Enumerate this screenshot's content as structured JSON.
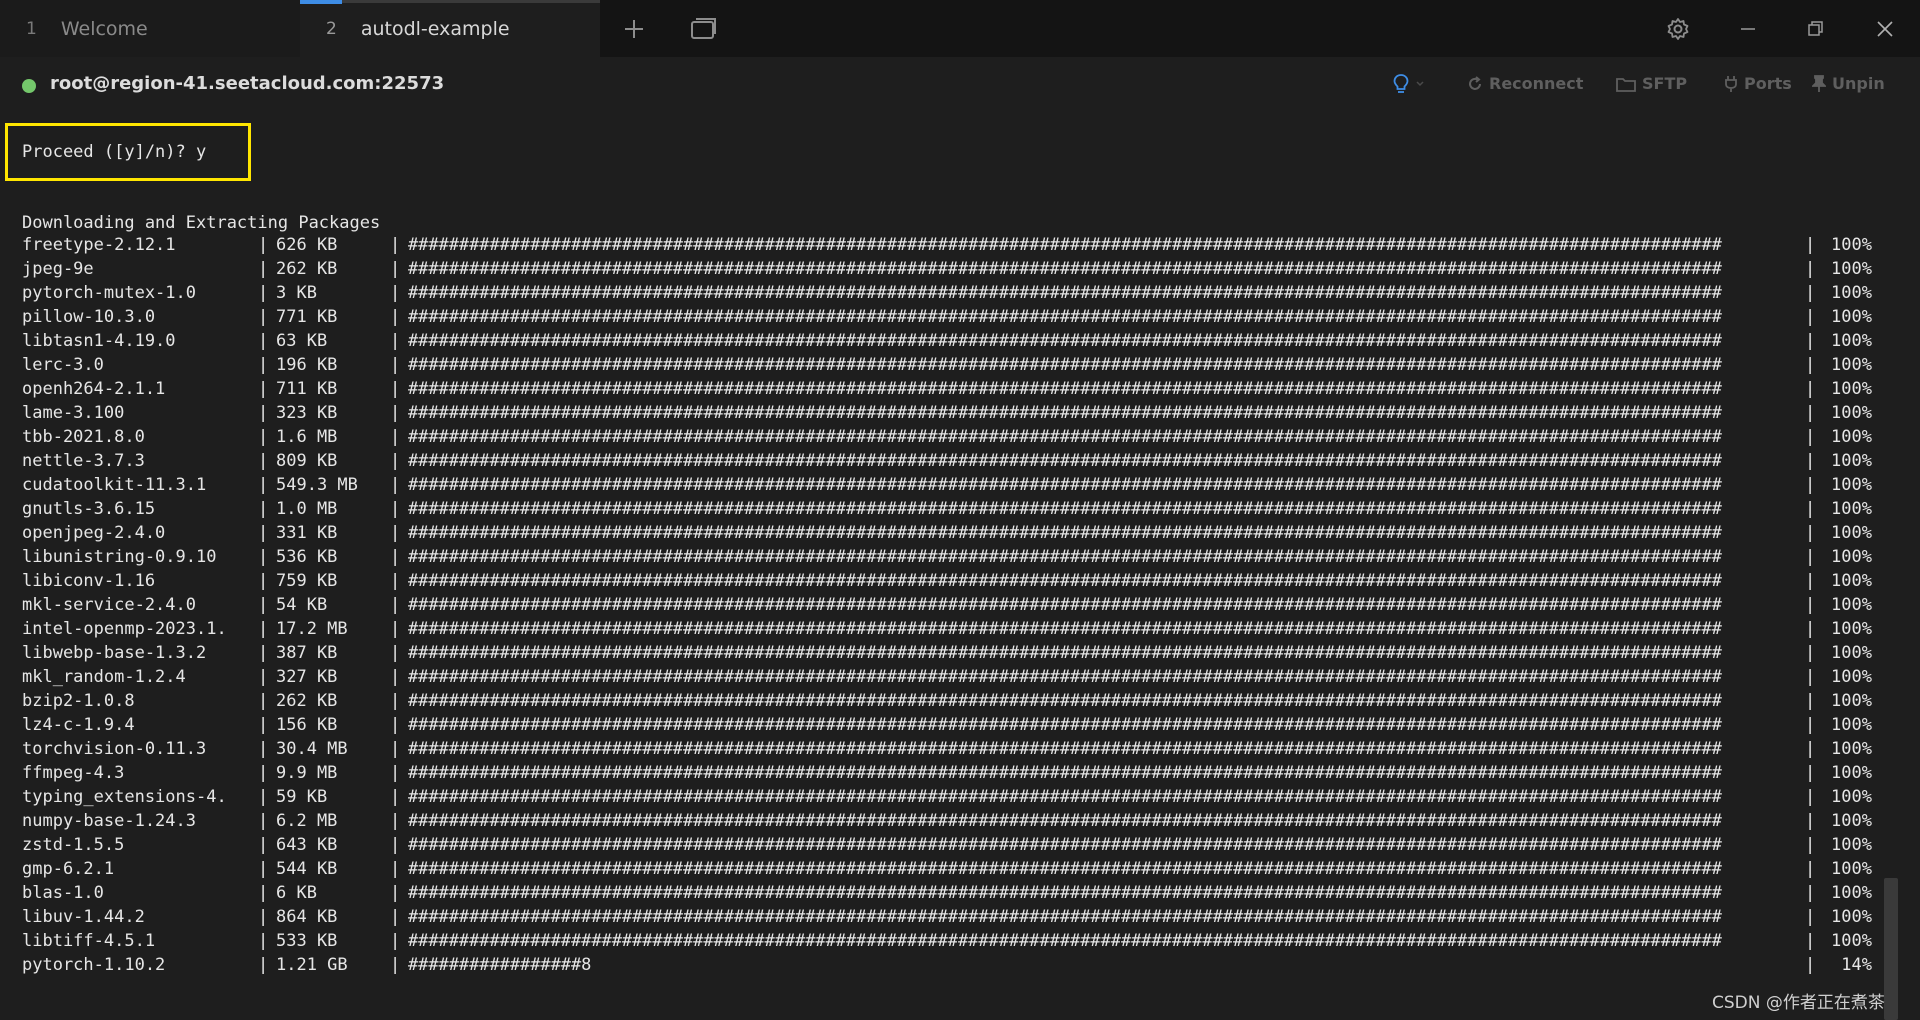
{
  "tabs": [
    {
      "number": "1",
      "label": "Welcome"
    },
    {
      "number": "2",
      "label": "autodl-example"
    }
  ],
  "connection": {
    "host": "root@region-41.seetacloud.com:22573",
    "status_color": "#74c76b"
  },
  "toolbar": {
    "reconnect": "Reconnect",
    "sftp": "SFTP",
    "ports": "Ports",
    "unpin": "Unpin"
  },
  "terminal": {
    "prompt": "Proceed ([y]/n)? y",
    "header": "Downloading and Extracting Packages",
    "separator": "|",
    "packages": [
      {
        "name": "freetype-2.12.1",
        "size": "626 KB",
        "bar": "#################################################################################################################################",
        "percent": "100%"
      },
      {
        "name": "jpeg-9e",
        "size": "262 KB",
        "bar": "#################################################################################################################################",
        "percent": "100%"
      },
      {
        "name": "pytorch-mutex-1.0",
        "size": "3 KB",
        "bar": "#################################################################################################################################",
        "percent": "100%"
      },
      {
        "name": "pillow-10.3.0",
        "size": "771 KB",
        "bar": "#################################################################################################################################",
        "percent": "100%"
      },
      {
        "name": "libtasn1-4.19.0",
        "size": "63 KB",
        "bar": "#################################################################################################################################",
        "percent": "100%"
      },
      {
        "name": "lerc-3.0",
        "size": "196 KB",
        "bar": "#################################################################################################################################",
        "percent": "100%"
      },
      {
        "name": "openh264-2.1.1",
        "size": "711 KB",
        "bar": "#################################################################################################################################",
        "percent": "100%"
      },
      {
        "name": "lame-3.100",
        "size": "323 KB",
        "bar": "#################################################################################################################################",
        "percent": "100%"
      },
      {
        "name": "tbb-2021.8.0",
        "size": "1.6 MB",
        "bar": "#################################################################################################################################",
        "percent": "100%"
      },
      {
        "name": "nettle-3.7.3",
        "size": "809 KB",
        "bar": "#################################################################################################################################",
        "percent": "100%"
      },
      {
        "name": "cudatoolkit-11.3.1",
        "size": "549.3 MB",
        "bar": "#################################################################################################################################",
        "percent": "100%"
      },
      {
        "name": "gnutls-3.6.15",
        "size": "1.0 MB",
        "bar": "#################################################################################################################################",
        "percent": "100%"
      },
      {
        "name": "openjpeg-2.4.0",
        "size": "331 KB",
        "bar": "#################################################################################################################################",
        "percent": "100%"
      },
      {
        "name": "libunistring-0.9.10",
        "size": "536 KB",
        "bar": "#################################################################################################################################",
        "percent": "100%"
      },
      {
        "name": "libiconv-1.16",
        "size": "759 KB",
        "bar": "#################################################################################################################################",
        "percent": "100%"
      },
      {
        "name": "mkl-service-2.4.0",
        "size": "54 KB",
        "bar": "#################################################################################################################################",
        "percent": "100%"
      },
      {
        "name": "intel-openmp-2023.1.",
        "size": "17.2 MB",
        "bar": "#################################################################################################################################",
        "percent": "100%"
      },
      {
        "name": "libwebp-base-1.3.2",
        "size": "387 KB",
        "bar": "#################################################################################################################################",
        "percent": "100%"
      },
      {
        "name": "mkl_random-1.2.4",
        "size": "327 KB",
        "bar": "#################################################################################################################################",
        "percent": "100%"
      },
      {
        "name": "bzip2-1.0.8",
        "size": "262 KB",
        "bar": "#################################################################################################################################",
        "percent": "100%"
      },
      {
        "name": "lz4-c-1.9.4",
        "size": "156 KB",
        "bar": "#################################################################################################################################",
        "percent": "100%"
      },
      {
        "name": "torchvision-0.11.3",
        "size": "30.4 MB",
        "bar": "#################################################################################################################################",
        "percent": "100%"
      },
      {
        "name": "ffmpeg-4.3",
        "size": "9.9 MB",
        "bar": "#################################################################################################################################",
        "percent": "100%"
      },
      {
        "name": "typing_extensions-4.",
        "size": "59 KB",
        "bar": "#################################################################################################################################",
        "percent": "100%"
      },
      {
        "name": "numpy-base-1.24.3",
        "size": "6.2 MB",
        "bar": "#################################################################################################################################",
        "percent": "100%"
      },
      {
        "name": "zstd-1.5.5",
        "size": "643 KB",
        "bar": "#################################################################################################################################",
        "percent": "100%"
      },
      {
        "name": "gmp-6.2.1",
        "size": "544 KB",
        "bar": "#################################################################################################################################",
        "percent": "100%"
      },
      {
        "name": "blas-1.0",
        "size": "6 KB",
        "bar": "#################################################################################################################################",
        "percent": "100%"
      },
      {
        "name": "libuv-1.44.2",
        "size": "864 KB",
        "bar": "#################################################################################################################################",
        "percent": "100%"
      },
      {
        "name": "libtiff-4.5.1",
        "size": "533 KB",
        "bar": "#################################################################################################################################",
        "percent": "100%"
      },
      {
        "name": "pytorch-1.10.2",
        "size": "1.21 GB",
        "bar": "#################8",
        "percent": "14%"
      }
    ]
  },
  "watermark": "CSDN @作者正在煮茶",
  "colors": {
    "accent": "#3e8de6",
    "highlight_box": "#ffe600",
    "bulb": "#3e8de6"
  }
}
